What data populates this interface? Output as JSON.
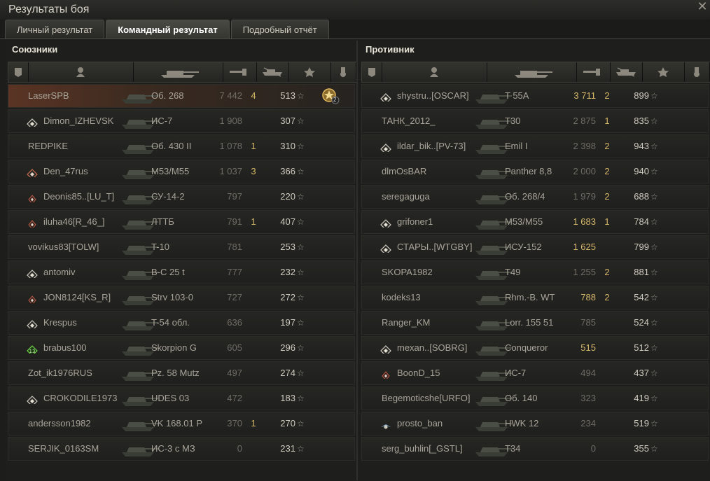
{
  "window": {
    "title": "Результаты боя",
    "close_symbol": "✕"
  },
  "tabs": [
    {
      "label": "Личный результат",
      "active": false
    },
    {
      "label": "Командный результат",
      "active": true
    },
    {
      "label": "Подробный отчёт",
      "active": false
    }
  ],
  "allies": {
    "title": "Союзники",
    "rows": [
      {
        "player": "LaserSPB",
        "tank": "Об. 268",
        "damage": "7 442",
        "kills": "4",
        "xp": "513",
        "icon": "none",
        "highlight": true,
        "medal": "2"
      },
      {
        "player": "Dimon_IZHEVSK",
        "tank": "ИС-7",
        "damage": "1 908",
        "kills": "",
        "xp": "307",
        "icon": "diamond"
      },
      {
        "player": "REDPIKE",
        "tank": "Об. 430 II",
        "damage": "1 078",
        "kills": "1",
        "xp": "310",
        "icon": "none"
      },
      {
        "player": "Den_47rus",
        "tank": "M53/M55",
        "damage": "1 037",
        "kills": "3",
        "xp": "366",
        "icon": "diamond-red"
      },
      {
        "player": "Deonis85..[LU_T]",
        "tank": "СУ-14-2",
        "damage": "797",
        "kills": "",
        "xp": "220",
        "icon": "diamond-red-small"
      },
      {
        "player": "iluha46[R_46_]",
        "tank": "ЛТТБ",
        "damage": "791",
        "kills": "1",
        "xp": "407",
        "icon": "diamond-red-small"
      },
      {
        "player": "vovikus83[TOLW]",
        "tank": "T-10",
        "damage": "781",
        "kills": "",
        "xp": "253",
        "icon": "none"
      },
      {
        "player": "antomiv",
        "tank": "B-C 25 t",
        "damage": "777",
        "kills": "",
        "xp": "232",
        "icon": "diamond"
      },
      {
        "player": "JON8124[KS_R]",
        "tank": "Strv 103-0",
        "damage": "727",
        "kills": "",
        "xp": "272",
        "icon": "diamond-red-small"
      },
      {
        "player": "Krespus",
        "tank": "T-54 обл.",
        "damage": "636",
        "kills": "",
        "xp": "197",
        "icon": "diamond"
      },
      {
        "player": "brabus100",
        "tank": "Skorpion G",
        "damage": "605",
        "kills": "",
        "xp": "296",
        "icon": "green-13"
      },
      {
        "player": "Zot_ik1976RUS",
        "tank": "Pz. 58 Mutz",
        "damage": "497",
        "kills": "",
        "xp": "274",
        "icon": "none"
      },
      {
        "player": "CROKODILE1973",
        "tank": "UDES 03",
        "damage": "472",
        "kills": "",
        "xp": "183",
        "icon": "diamond"
      },
      {
        "player": "andersson1982",
        "tank": "VK 168.01 P",
        "damage": "370",
        "kills": "1",
        "xp": "270",
        "icon": "none"
      },
      {
        "player": "SERJIK_0163SM",
        "tank": "ИС-3 с МЗ",
        "damage": "0",
        "kills": "",
        "xp": "231",
        "icon": "none"
      }
    ]
  },
  "enemies": {
    "title": "Противник",
    "rows": [
      {
        "player": "shystru..[OSCAR]",
        "tank": "T 55A",
        "damage": "3 711",
        "kills": "2",
        "xp": "899",
        "icon": "diamond",
        "dmg_hi": true
      },
      {
        "player": "ТАНК_2012_",
        "tank": "T30",
        "damage": "2 875",
        "kills": "1",
        "xp": "835",
        "icon": "none"
      },
      {
        "player": "ildar_bik..[PV-73]",
        "tank": "Emil I",
        "damage": "2 398",
        "kills": "2",
        "xp": "943",
        "icon": "diamond"
      },
      {
        "player": "dlmOsBAR",
        "tank": "Panther 8,8",
        "damage": "2 000",
        "kills": "2",
        "xp": "940",
        "icon": "none"
      },
      {
        "player": "seregaguga",
        "tank": "Об. 268/4",
        "damage": "1 979",
        "kills": "2",
        "xp": "688",
        "icon": "none"
      },
      {
        "player": "grifoner1",
        "tank": "M53/M55",
        "damage": "1 683",
        "kills": "1",
        "xp": "784",
        "icon": "diamond",
        "dmg_hi": true
      },
      {
        "player": "СТАРЫ..[WTGBY]",
        "tank": "ИСУ-152",
        "damage": "1 625",
        "kills": "",
        "xp": "799",
        "icon": "diamond",
        "dmg_hi": true
      },
      {
        "player": "SKOPA1982",
        "tank": "T49",
        "damage": "1 255",
        "kills": "2",
        "xp": "881",
        "icon": "none"
      },
      {
        "player": "kodeks13",
        "tank": "Rhm.-B. WT",
        "damage": "788",
        "kills": "2",
        "xp": "542",
        "icon": "none",
        "dmg_hi": true
      },
      {
        "player": "Ranger_KM",
        "tank": "Lorr. 155 51",
        "damage": "785",
        "kills": "",
        "xp": "524",
        "icon": "none"
      },
      {
        "player": "mexan..[SOBRG]",
        "tank": "Conqueror",
        "damage": "515",
        "kills": "",
        "xp": "512",
        "icon": "diamond",
        "dmg_hi": true
      },
      {
        "player": "BoonD_15",
        "tank": "ИС-7",
        "damage": "494",
        "kills": "",
        "xp": "437",
        "icon": "diamond-red-small"
      },
      {
        "player": "Begemoticshe[URFO]",
        "tank": "Об. 140",
        "damage": "323",
        "kills": "",
        "xp": "419",
        "icon": "none"
      },
      {
        "player": "prosto_ban",
        "tank": "HWK 12",
        "damage": "234",
        "kills": "",
        "xp": "519",
        "icon": "wings"
      },
      {
        "player": "serg_buhlin[_GSTL]",
        "tank": "T34",
        "damage": "0",
        "kills": "",
        "xp": "355",
        "icon": "none"
      }
    ]
  },
  "colors": {
    "accent": "#d6b86a",
    "highlight_row": "#5a3424",
    "text": "#a8a499"
  },
  "star_symbol": "☆"
}
